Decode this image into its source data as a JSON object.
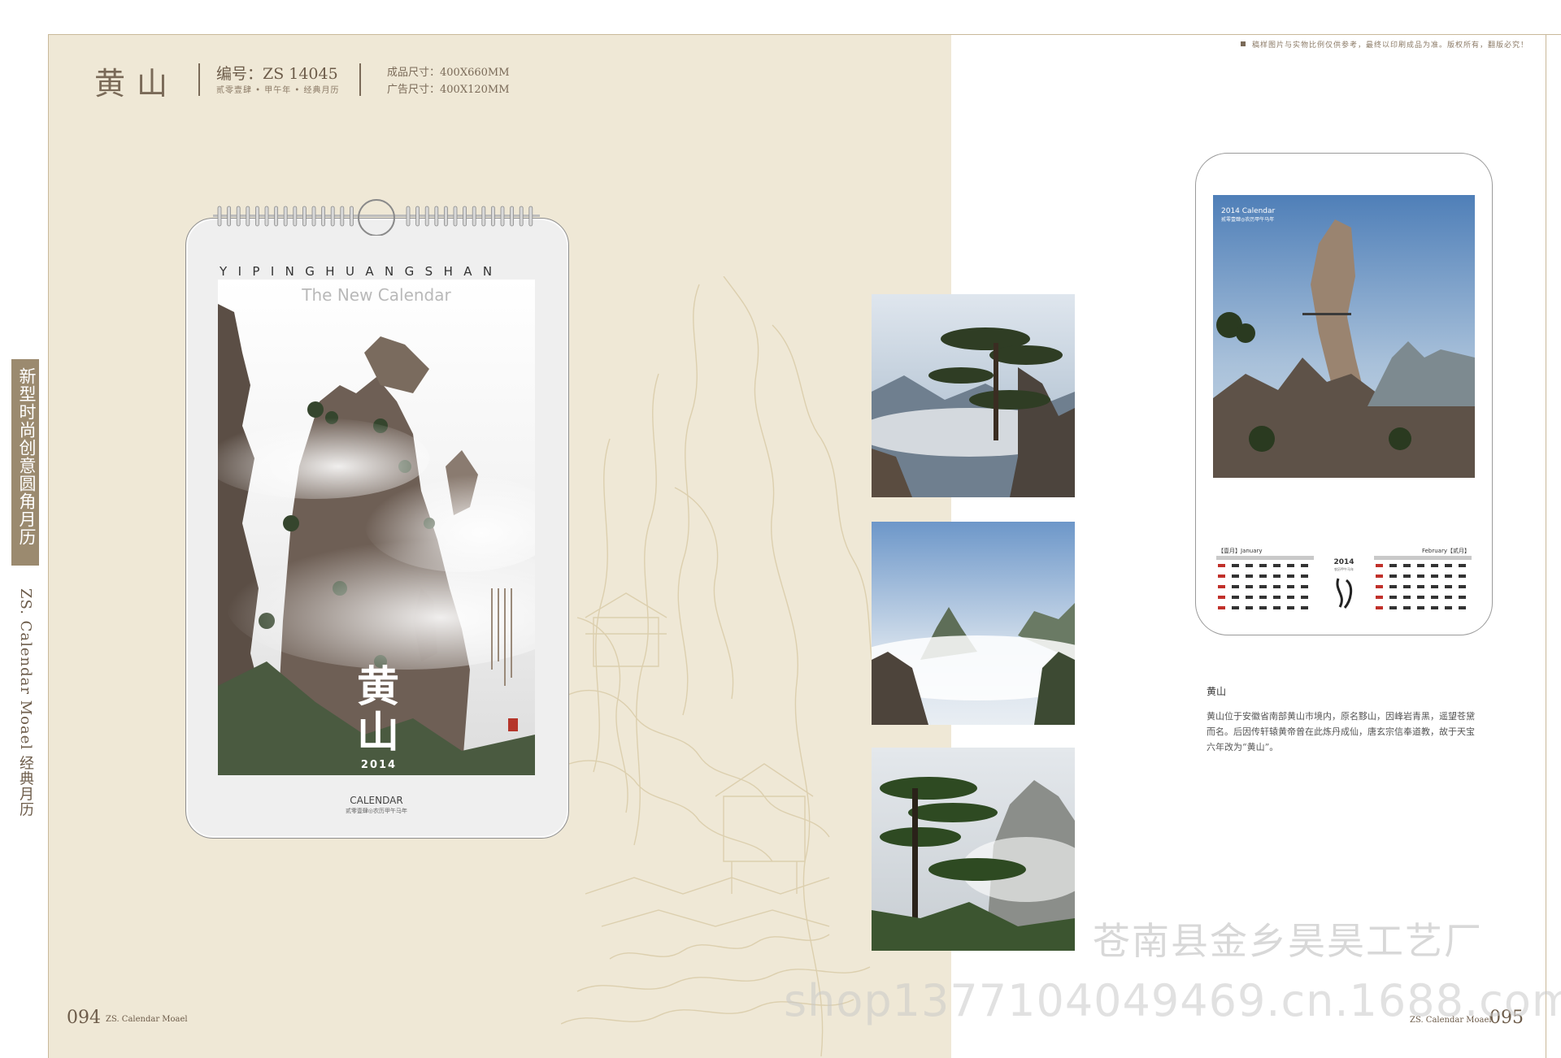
{
  "header": {
    "title": "黄山",
    "code": "编号：ZS 14045",
    "code_sub": "贰零壹肆 • 甲午年 • 经典月历",
    "size_product": "成品尺寸：400X660MM",
    "size_ad": "广告尺寸：400X120MM",
    "notice": "稿样图片与实物比例仅供参考，最终以印刷成品为准。版权所有，翻版必究！"
  },
  "side_tab": {
    "label": "新型时尚创意圆角月历",
    "en": "ZS. Calendar Moael  经典月历"
  },
  "calendar": {
    "letters": "YIPINGHUANGSHAN",
    "subtitle": "The New Calendar",
    "big_chars": "黄山",
    "year": "2014",
    "footer": "CALENDAR",
    "footer_small": "贰零壹肆◎农历甲午马年"
  },
  "preview": {
    "caption_title": "2014 Calendar",
    "caption_sub": "贰零壹肆◎农历甲午马年",
    "mini_calendar": {
      "left_month": "【壹月】January",
      "right_month": "February【贰月】",
      "center_year": "2014",
      "center_note": "农历甲午马年"
    }
  },
  "description": {
    "title": "黄山",
    "text": "黄山位于安徽省南部黄山市境内，原名黟山，因峰岩青黑，遥望苍黛而名。后因传轩辕黄帝曾在此炼丹成仙，唐玄宗信奉道教，故于天宝六年改为“黄山”。"
  },
  "footer": {
    "left_num": "094",
    "left_en": "ZS. Calendar Moael",
    "right_en": "ZS. Calendar Moael",
    "right_num": "095"
  },
  "watermark": {
    "company": "苍南县金乡昊昊工艺厂",
    "url": "shop1377104049469.cn.1688.com"
  },
  "colors": {
    "beige": "#efe8d6",
    "brown": "#7a6a58",
    "tab": "#9b8a6f"
  }
}
